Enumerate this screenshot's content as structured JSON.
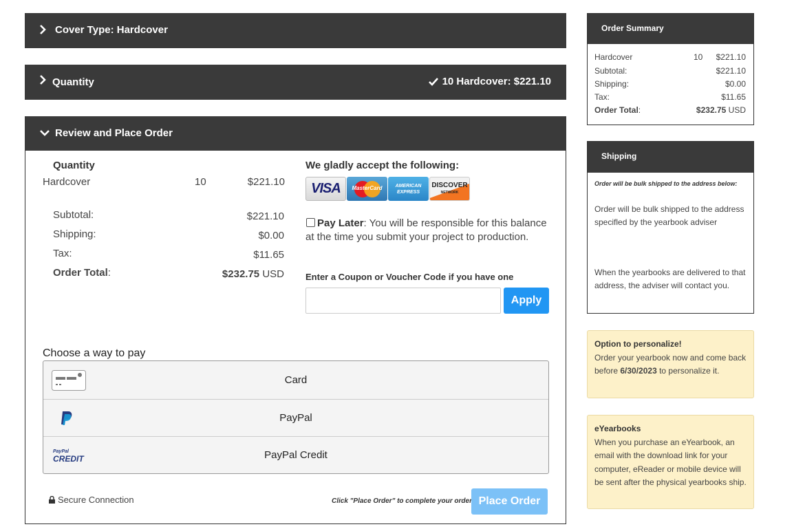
{
  "sections": {
    "cover": {
      "title": "Cover Type: Hardcover"
    },
    "quantity": {
      "title": "Quantity",
      "summary": "10 Hardcover: $221.10"
    },
    "review": {
      "title": "Review and Place Order"
    }
  },
  "order": {
    "heading": "Quantity",
    "item_name": "Hardcover",
    "item_qty": "10",
    "item_price": "$221.10",
    "subtotal_label": "Subtotal:",
    "subtotal": "$221.10",
    "shipping_label": "Shipping:",
    "shipping": "$0.00",
    "tax_label": "Tax:",
    "tax": "$11.65",
    "total_label": "Order Total",
    "total_colon": ":",
    "total": "$232.75",
    "currency": "USD"
  },
  "payment": {
    "accept_heading": "We gladly accept the following:",
    "card_logos": {
      "visa": "VISA",
      "mastercard": "MasterCard",
      "amex_1": "AMERICAN",
      "amex_2": "EXPRESS",
      "discover": "DISCOVER",
      "discover_sub": "NETWORK"
    },
    "pay_later_label": "Pay Later",
    "pay_later_text": ": You will be responsible for this balance at the time you submit your project to production.",
    "coupon_label": "Enter a Coupon or Voucher Code if you have one",
    "coupon_value": "",
    "apply_label": "Apply",
    "choose_label": "Choose a way to pay",
    "methods": [
      "Card",
      "PayPal",
      "PayPal Credit"
    ],
    "paypal_credit_logo_top": "PayPal",
    "paypal_credit_logo_bottom": "CREDIT",
    "secure_label": "Secure Connection",
    "click_note": "Click \"Place Order\" to complete your order.",
    "place_order_label": "Place Order"
  },
  "summary": {
    "title": "Order Summary",
    "item_name": "Hardcover",
    "item_qty": "10",
    "item_price": "$221.10",
    "subtotal_label": "Subtotal:",
    "subtotal": "$221.10",
    "shipping_label": "Shipping:",
    "shipping": "$0.00",
    "tax_label": "Tax:",
    "tax": "$11.65",
    "total_label": "Order Total",
    "total_colon": ":",
    "total": "$232.75",
    "currency": "USD"
  },
  "shipping_panel": {
    "title": "Shipping",
    "note": "Order will be bulk shipped to the address below:",
    "text1": "Order will be bulk shipped to the address specifled by the yearbook adviser",
    "text2": "When the yearbooks are delivered to that address, the adviser will contact you."
  },
  "personalize": {
    "title": "Option to personalize!",
    "text_before": "Order your yearbook now and come back before ",
    "date": "6/30/2023",
    "text_after": " to personalize it."
  },
  "eyearbooks": {
    "title": "eYearbooks",
    "text": "When you purchase an eYearbook, an email with the download link for your computer, eReader or mobile device will be sent after the physical yearbooks ship."
  },
  "colors": {
    "header_bg": "#3a3a3a",
    "apply_blue": "#2196f3",
    "place_order_blue": "#7cc1f7",
    "note_bg": "#fdf1c9"
  },
  "icons": {
    "collapsed": "chevron-right-icon",
    "expanded": "chevron-down-icon",
    "done": "checkmark-icon",
    "secure": "lock-icon"
  }
}
